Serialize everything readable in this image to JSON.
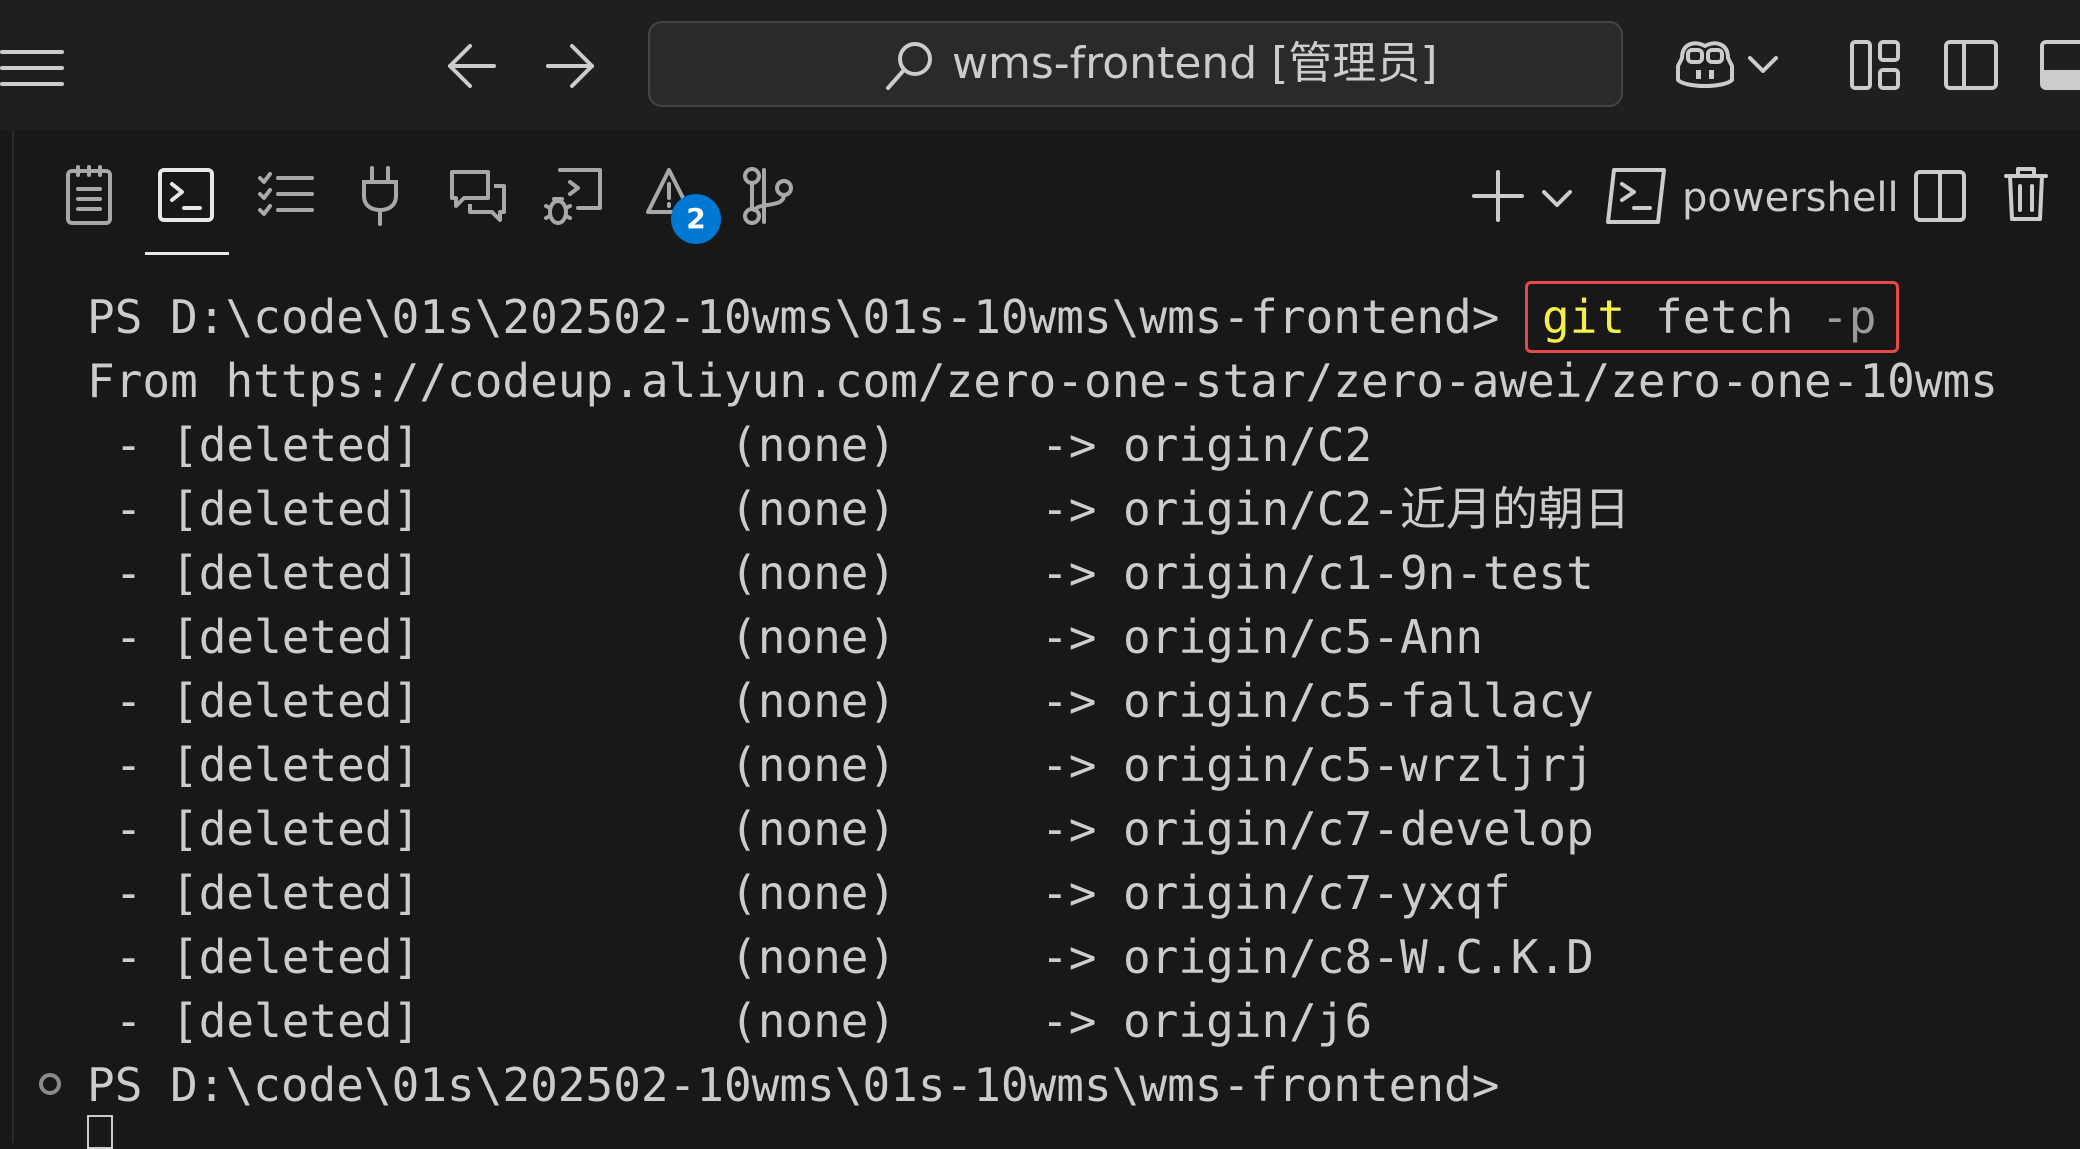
{
  "title_bar": {
    "search_text": "wms-frontend [管理员]"
  },
  "panel": {
    "active_tab": "terminal",
    "problems_badge": "2",
    "shell_name": "powershell"
  },
  "terminal": {
    "prompt": "PS D:\\code\\01s\\202502-10wms\\01s-10wms\\wms-frontend>",
    "command": {
      "program": "git",
      "subcommand": "fetch",
      "flag": "-p"
    },
    "from_line": "From https://codeup.aliyun.com/zero-one-star/zero-awei/zero-one-10wms",
    "deleted_rows": [
      {
        "marker": " - ",
        "status": "[deleted]",
        "source": "(none)",
        "arrow": "->",
        "ref": "origin/C2"
      },
      {
        "marker": " - ",
        "status": "[deleted]",
        "source": "(none)",
        "arrow": "->",
        "ref": "origin/C2-近月的朝日"
      },
      {
        "marker": " - ",
        "status": "[deleted]",
        "source": "(none)",
        "arrow": "->",
        "ref": "origin/c1-9n-test"
      },
      {
        "marker": " - ",
        "status": "[deleted]",
        "source": "(none)",
        "arrow": "->",
        "ref": "origin/c5-Ann"
      },
      {
        "marker": " - ",
        "status": "[deleted]",
        "source": "(none)",
        "arrow": "->",
        "ref": "origin/c5-fallacy"
      },
      {
        "marker": " - ",
        "status": "[deleted]",
        "source": "(none)",
        "arrow": "->",
        "ref": "origin/c5-wrzljrj"
      },
      {
        "marker": " - ",
        "status": "[deleted]",
        "source": "(none)",
        "arrow": "->",
        "ref": "origin/c7-develop"
      },
      {
        "marker": " - ",
        "status": "[deleted]",
        "source": "(none)",
        "arrow": "->",
        "ref": "origin/c7-yxqf"
      },
      {
        "marker": " - ",
        "status": "[deleted]",
        "source": "(none)",
        "arrow": "->",
        "ref": "origin/c8-W.C.K.D"
      },
      {
        "marker": " - ",
        "status": "[deleted]",
        "source": "(none)",
        "arrow": "->",
        "ref": "origin/j6"
      }
    ],
    "final_prompt": "PS D:\\code\\01s\\202502-10wms\\01s-10wms\\wms-frontend>"
  },
  "colors": {
    "background": "#181818",
    "text": "#cccccc",
    "git_keyword": "#f3f04d",
    "highlight_border": "#e5484d",
    "badge": "#0078d4"
  }
}
